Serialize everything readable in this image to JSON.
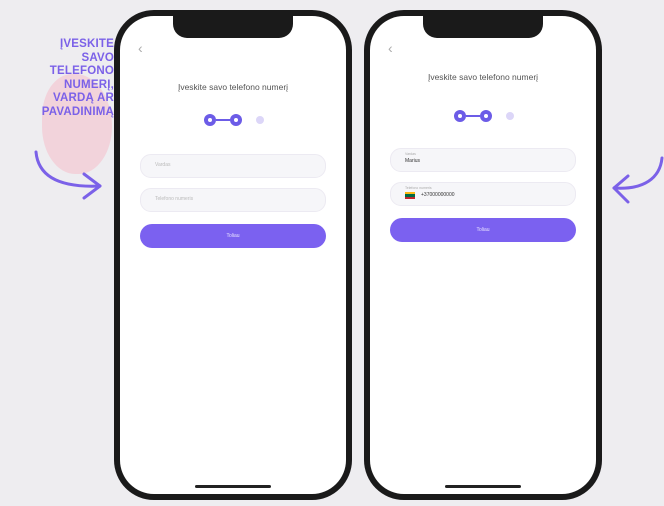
{
  "annotation": {
    "lines": [
      "ĮVESKITE",
      "SAVO",
      "TELEFONO",
      "NUMERĮ,",
      "VARDĄ  AR",
      "PAVADINIMĄ"
    ]
  },
  "colors": {
    "accent": "#7b61f0",
    "annotation": "#7b61e8",
    "background": "#eeedf0"
  },
  "left_phone": {
    "back_icon": "chevron-left-icon",
    "title": "Įveskite savo telefono numerį",
    "steps": {
      "current": 2,
      "total": 3
    },
    "name_field": {
      "placeholder": "Vardas"
    },
    "phone_field": {
      "placeholder": "Telefono numeris"
    },
    "button_label": "Toliau"
  },
  "right_phone": {
    "back_icon": "chevron-left-icon",
    "title": "Įveskite savo telefono numerį",
    "steps": {
      "current": 2,
      "total": 3
    },
    "name_field": {
      "label": "Vardas",
      "value": "Marius"
    },
    "phone_field": {
      "label": "Telefono numeris",
      "value": "+37000000000",
      "flag_icon": "lithuania-flag-icon"
    },
    "button_label": "Toliau"
  }
}
